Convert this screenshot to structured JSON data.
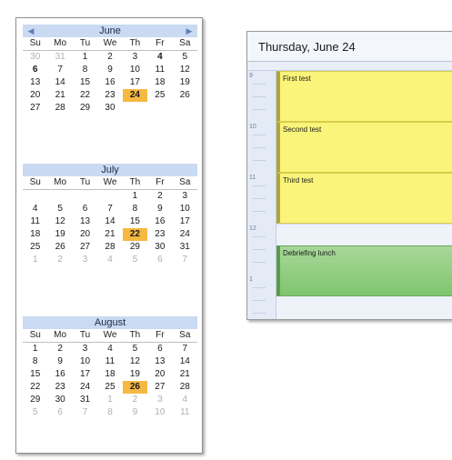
{
  "mini_calendar": {
    "dow": [
      "Su",
      "Mo",
      "Tu",
      "We",
      "Th",
      "Fr",
      "Sa"
    ],
    "nav": {
      "prev": "◀",
      "next": "▶"
    },
    "months": [
      {
        "name": "June",
        "weeks": [
          [
            [
              "30",
              "o"
            ],
            [
              "31",
              "o"
            ],
            [
              "1",
              ""
            ],
            [
              "2",
              ""
            ],
            [
              "3",
              ""
            ],
            [
              "4",
              "b"
            ],
            [
              "5",
              ""
            ]
          ],
          [
            [
              "6",
              "b"
            ],
            [
              "7",
              ""
            ],
            [
              "8",
              ""
            ],
            [
              "9",
              ""
            ],
            [
              "10",
              ""
            ],
            [
              "11",
              ""
            ],
            [
              "12",
              ""
            ]
          ],
          [
            [
              "13",
              ""
            ],
            [
              "14",
              ""
            ],
            [
              "15",
              ""
            ],
            [
              "16",
              ""
            ],
            [
              "17",
              ""
            ],
            [
              "18",
              ""
            ],
            [
              "19",
              ""
            ]
          ],
          [
            [
              "20",
              ""
            ],
            [
              "21",
              ""
            ],
            [
              "22",
              ""
            ],
            [
              "23",
              ""
            ],
            [
              "24",
              "s"
            ],
            [
              "25",
              ""
            ],
            [
              "26",
              ""
            ]
          ],
          [
            [
              "27",
              ""
            ],
            [
              "28",
              ""
            ],
            [
              "29",
              ""
            ],
            [
              "30",
              ""
            ],
            [
              "",
              ""
            ],
            [
              "",
              ""
            ],
            [
              "",
              ""
            ]
          ]
        ]
      },
      {
        "name": "July",
        "weeks": [
          [
            [
              "",
              ""
            ],
            [
              "",
              ""
            ],
            [
              "",
              ""
            ],
            [
              "",
              ""
            ],
            [
              "1",
              ""
            ],
            [
              "2",
              ""
            ],
            [
              "3",
              ""
            ]
          ],
          [
            [
              "4",
              ""
            ],
            [
              "5",
              ""
            ],
            [
              "6",
              ""
            ],
            [
              "7",
              ""
            ],
            [
              "8",
              ""
            ],
            [
              "9",
              ""
            ],
            [
              "10",
              ""
            ]
          ],
          [
            [
              "11",
              ""
            ],
            [
              "12",
              ""
            ],
            [
              "13",
              ""
            ],
            [
              "14",
              ""
            ],
            [
              "15",
              ""
            ],
            [
              "16",
              ""
            ],
            [
              "17",
              ""
            ]
          ],
          [
            [
              "18",
              ""
            ],
            [
              "19",
              ""
            ],
            [
              "20",
              ""
            ],
            [
              "21",
              ""
            ],
            [
              "22",
              "s"
            ],
            [
              "23",
              ""
            ],
            [
              "24",
              ""
            ]
          ],
          [
            [
              "25",
              ""
            ],
            [
              "26",
              ""
            ],
            [
              "27",
              ""
            ],
            [
              "28",
              ""
            ],
            [
              "29",
              ""
            ],
            [
              "30",
              ""
            ],
            [
              "31",
              ""
            ]
          ],
          [
            [
              "1",
              "o"
            ],
            [
              "2",
              "o"
            ],
            [
              "3",
              "o"
            ],
            [
              "4",
              "o"
            ],
            [
              "5",
              "o"
            ],
            [
              "6",
              "o"
            ],
            [
              "7",
              "o"
            ]
          ]
        ]
      },
      {
        "name": "August",
        "weeks": [
          [
            [
              "1",
              ""
            ],
            [
              "2",
              ""
            ],
            [
              "3",
              ""
            ],
            [
              "4",
              ""
            ],
            [
              "5",
              ""
            ],
            [
              "6",
              ""
            ],
            [
              "7",
              ""
            ]
          ],
          [
            [
              "8",
              ""
            ],
            [
              "9",
              ""
            ],
            [
              "10",
              ""
            ],
            [
              "11",
              ""
            ],
            [
              "12",
              ""
            ],
            [
              "13",
              ""
            ],
            [
              "14",
              ""
            ]
          ],
          [
            [
              "15",
              ""
            ],
            [
              "16",
              ""
            ],
            [
              "17",
              ""
            ],
            [
              "18",
              ""
            ],
            [
              "19",
              ""
            ],
            [
              "20",
              ""
            ],
            [
              "21",
              ""
            ]
          ],
          [
            [
              "22",
              ""
            ],
            [
              "23",
              ""
            ],
            [
              "24",
              ""
            ],
            [
              "25",
              ""
            ],
            [
              "26",
              "s"
            ],
            [
              "27",
              ""
            ],
            [
              "28",
              ""
            ]
          ],
          [
            [
              "29",
              ""
            ],
            [
              "30",
              ""
            ],
            [
              "31",
              ""
            ],
            [
              "1",
              "o"
            ],
            [
              "2",
              "o"
            ],
            [
              "3",
              "o"
            ],
            [
              "4",
              "o"
            ]
          ],
          [
            [
              "5",
              "o"
            ],
            [
              "6",
              "o"
            ],
            [
              "7",
              "o"
            ],
            [
              "8",
              "o"
            ],
            [
              "9",
              "o"
            ],
            [
              "10",
              "o"
            ],
            [
              "11",
              "o"
            ]
          ]
        ]
      }
    ]
  },
  "day_view": {
    "title": "Thursday, June 24",
    "hours": [
      "9",
      "10",
      "11",
      "12",
      "1"
    ],
    "appointments": [
      {
        "title": "First test",
        "color": "yellow"
      },
      {
        "title": "Second test",
        "color": "yellow"
      },
      {
        "title": "Third test",
        "color": "yellow"
      },
      {
        "title": "Debriefing lunch",
        "color": "green"
      }
    ]
  }
}
